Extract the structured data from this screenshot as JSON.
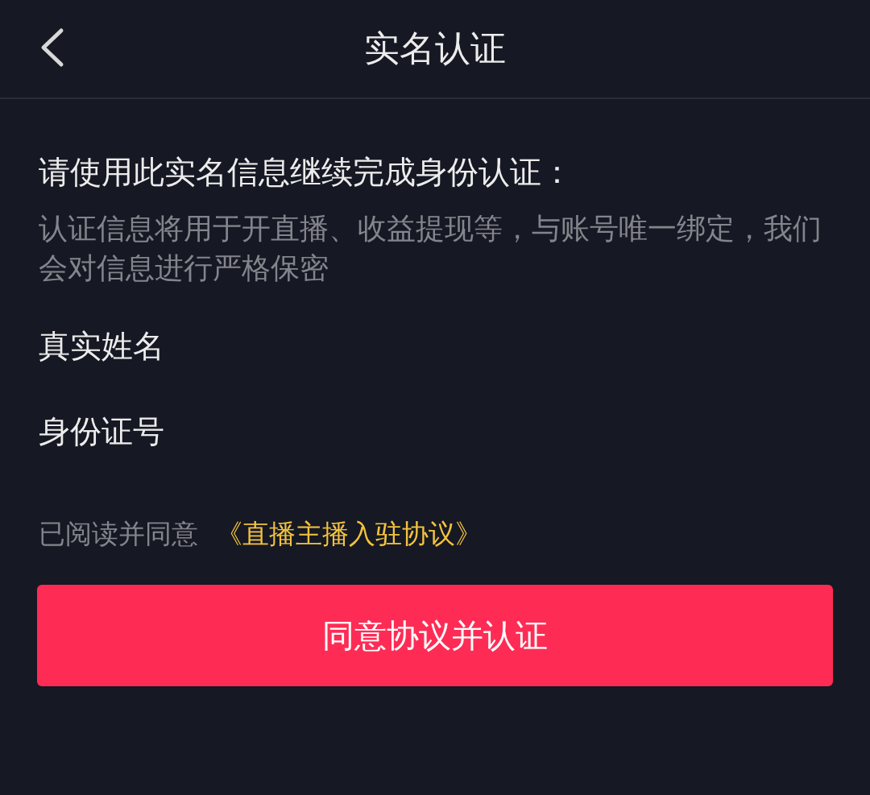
{
  "header": {
    "title": "实名认证"
  },
  "intro": {
    "heading": "请使用此实名信息继续完成身份认证：",
    "description": "认证信息将用于开直播、收益提现等，与账号唯一绑定，我们会对信息进行严格保密"
  },
  "fields": [
    {
      "label": "真实姓名"
    },
    {
      "label": "身份证号"
    }
  ],
  "agreement": {
    "text": "已阅读并同意",
    "link": "《直播主播入驻协议》"
  },
  "submit_button": "同意协议并认证"
}
